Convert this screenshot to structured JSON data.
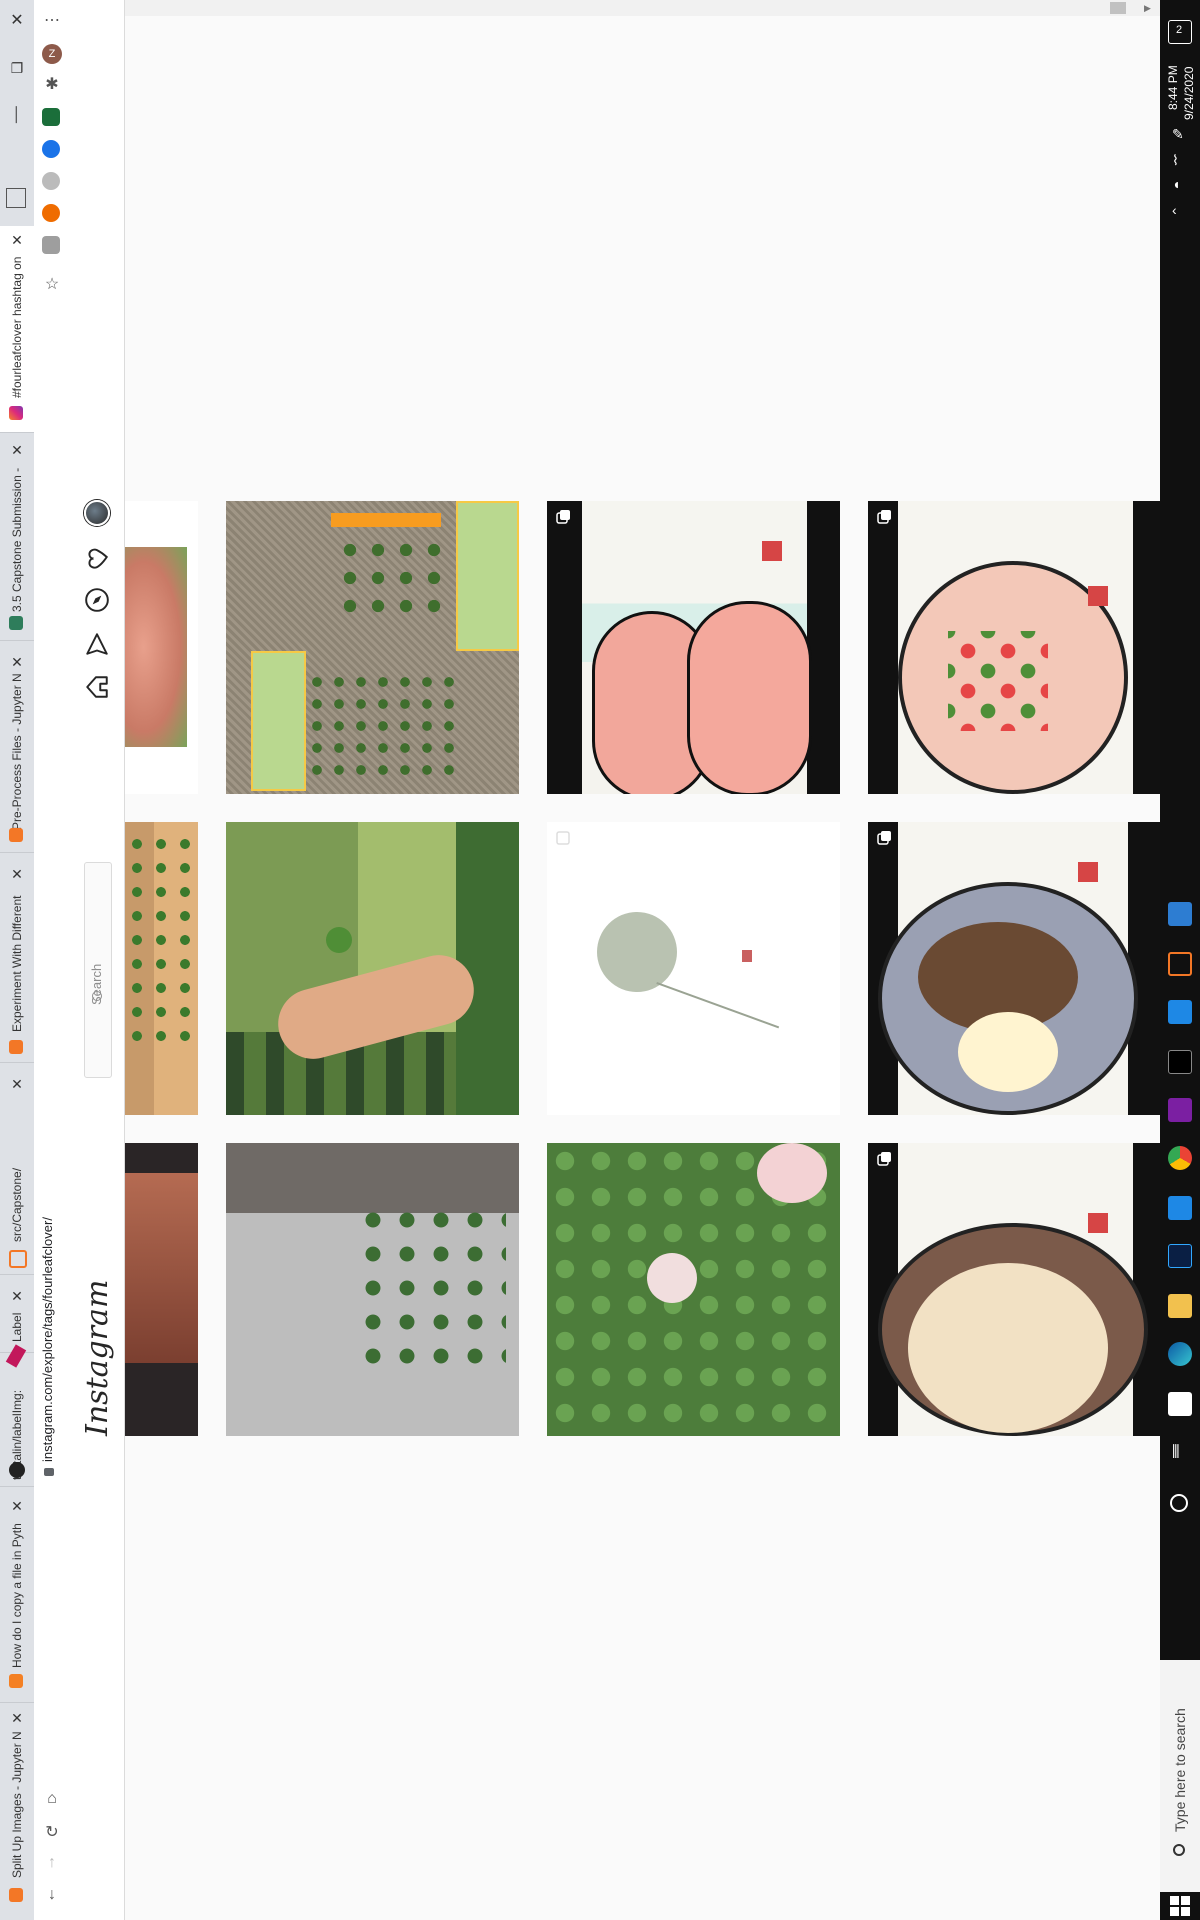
{
  "browser": {
    "tabs": [
      {
        "label": "#fourleafclover hashtag on",
        "active": true,
        "favicon": "instagram-icon"
      },
      {
        "label": "3.5 Capstone Submission -",
        "favicon": "page-icon"
      },
      {
        "label": "Pre-Process Files - Jupyter N",
        "favicon": "jupyter-icon"
      },
      {
        "label": "Experiment With Different",
        "favicon": "jupyter-icon"
      },
      {
        "label": "src/Capstone/",
        "favicon": "jupyter-icon"
      },
      {
        "label": "Label",
        "favicon": "pen-icon"
      },
      {
        "label": "tzutalin/labelImg:",
        "favicon": "github-icon"
      },
      {
        "label": "How do I copy a file in Pyth",
        "favicon": "stackoverflow-icon"
      },
      {
        "label": "Split Up Images - Jupyter N",
        "favicon": "jupyter-icon"
      }
    ],
    "url": "instagram.com/explore/tags/fourleafclover/",
    "profile_initial": "Z"
  },
  "instagram": {
    "logo": "Instagram",
    "search_placeholder": "Search"
  },
  "taskbar": {
    "search_placeholder": "Type here to search",
    "time": "8:44 PM",
    "date": "9/24/2020",
    "notification_count": "2"
  },
  "colors": {
    "taskbar": "#101010",
    "tabstrip": "#dee1e6",
    "ig_border": "#dbdbdb"
  }
}
